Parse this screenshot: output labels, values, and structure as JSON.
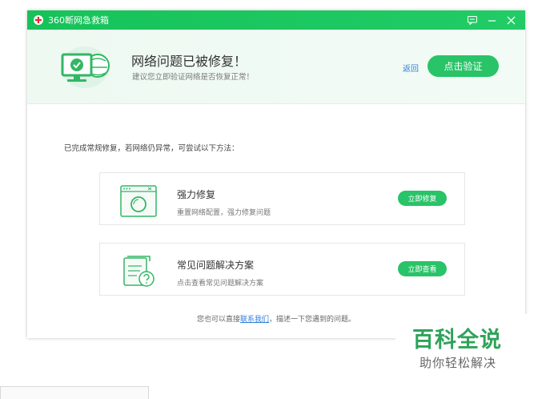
{
  "titlebar": {
    "title": "360断网急救箱",
    "logo_icon": "360-red-cross-icon"
  },
  "header": {
    "title": "网络问题已被修复！",
    "subtitle": "建议您立即验证网络是否恢复正常！",
    "back_label": "返回",
    "verify_label": "点击验证"
  },
  "hint": "已完成常规修复，若网络仍异常，可尝试以下方法：",
  "cards": [
    {
      "title": "强力修复",
      "desc": "重置网络配置，强力修复问题",
      "button": "立即修复",
      "icon": "washing-window-icon"
    },
    {
      "title": "常见问题解决方案",
      "desc": "点击查看常见问题解决方案",
      "button": "立即查看",
      "icon": "document-question-icon"
    }
  ],
  "contact": {
    "before": "您也可以直接",
    "link": "联系我们",
    "after": "，描述一下您遇到的问题。"
  },
  "watermark": {
    "title": "百科全说",
    "subtitle": "助你轻松解决"
  },
  "colors": {
    "accent": "#29c368",
    "link": "#2f7fd8",
    "watermark": "#2ea35a"
  }
}
